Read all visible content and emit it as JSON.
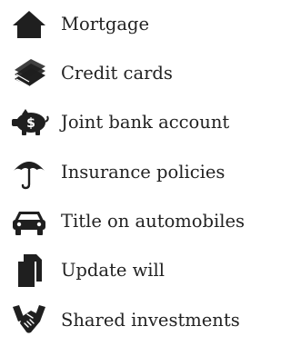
{
  "items": [
    {
      "label": "Mortgage",
      "icon": "house-icon"
    },
    {
      "label": "Credit cards",
      "icon": "credit-cards-icon"
    },
    {
      "label": "Joint bank account",
      "icon": "piggy-bank-icon"
    },
    {
      "label": "Insurance policies",
      "icon": "umbrella-icon"
    },
    {
      "label": "Title on automobiles",
      "icon": "car-icon"
    },
    {
      "label": "Update will",
      "icon": "document-icon"
    },
    {
      "label": "Shared investments",
      "icon": "handshake-icon"
    }
  ],
  "colors": {
    "icon": "#1f1f1f",
    "text": "#222222",
    "piggy_symbol": "#ffffff"
  }
}
